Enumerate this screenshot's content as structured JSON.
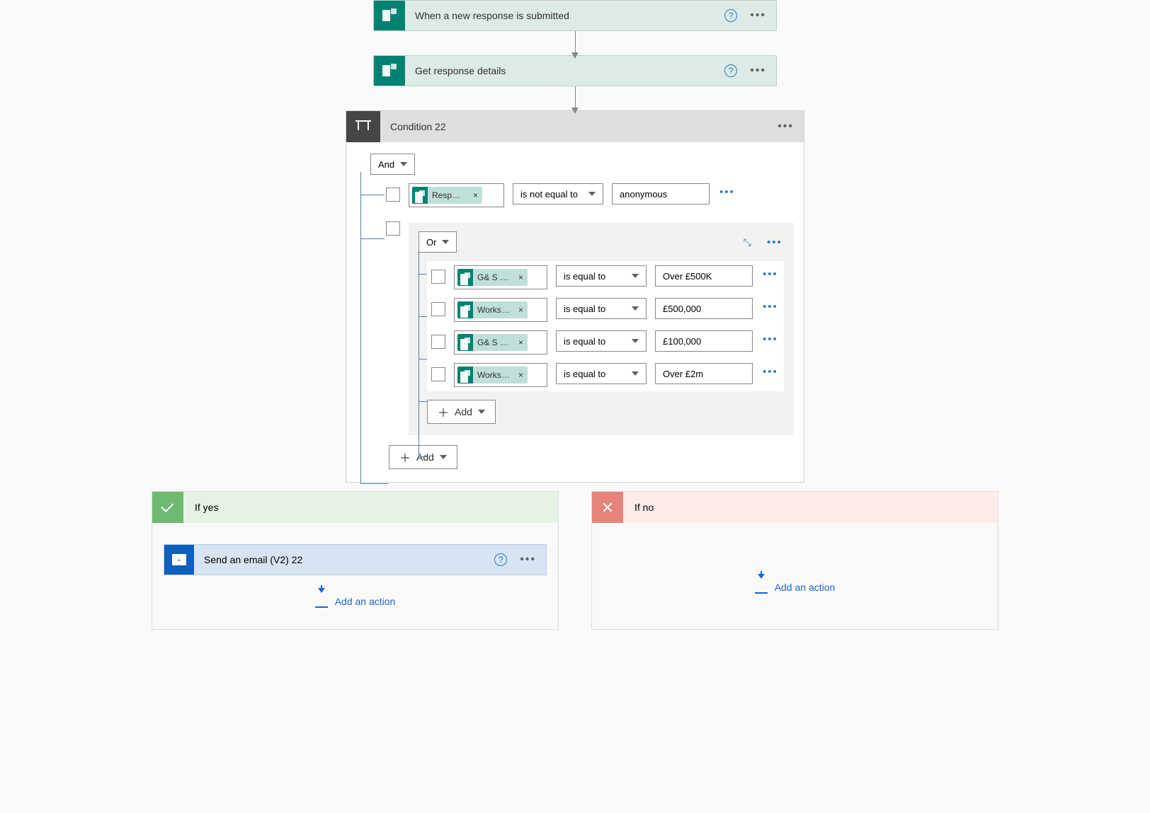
{
  "trigger": {
    "label": "When a new response is submitted"
  },
  "step2": {
    "label": "Get response details"
  },
  "condition": {
    "title": "Condition 22",
    "outer_op": "And",
    "row1": {
      "token": "Respons...",
      "operator": "is not equal to",
      "value": "anonymous"
    },
    "inner_op": "Or",
    "rows": [
      {
        "token": "G& S - ...",
        "operator": "is equal to",
        "value": "Over £500K"
      },
      {
        "token": "Works - ...",
        "operator": "is equal to",
        "value": "£500,000"
      },
      {
        "token": "G& S - ...",
        "operator": "is equal to",
        "value": "£100,000"
      },
      {
        "token": "Works - ...",
        "operator": "is equal to",
        "value": "Over £2m"
      }
    ],
    "add_label": "Add"
  },
  "branches": {
    "yes": {
      "title": "If yes",
      "action": "Send an email (V2) 22",
      "add_action": "Add an action"
    },
    "no": {
      "title": "If no",
      "add_action": "Add an action"
    }
  }
}
